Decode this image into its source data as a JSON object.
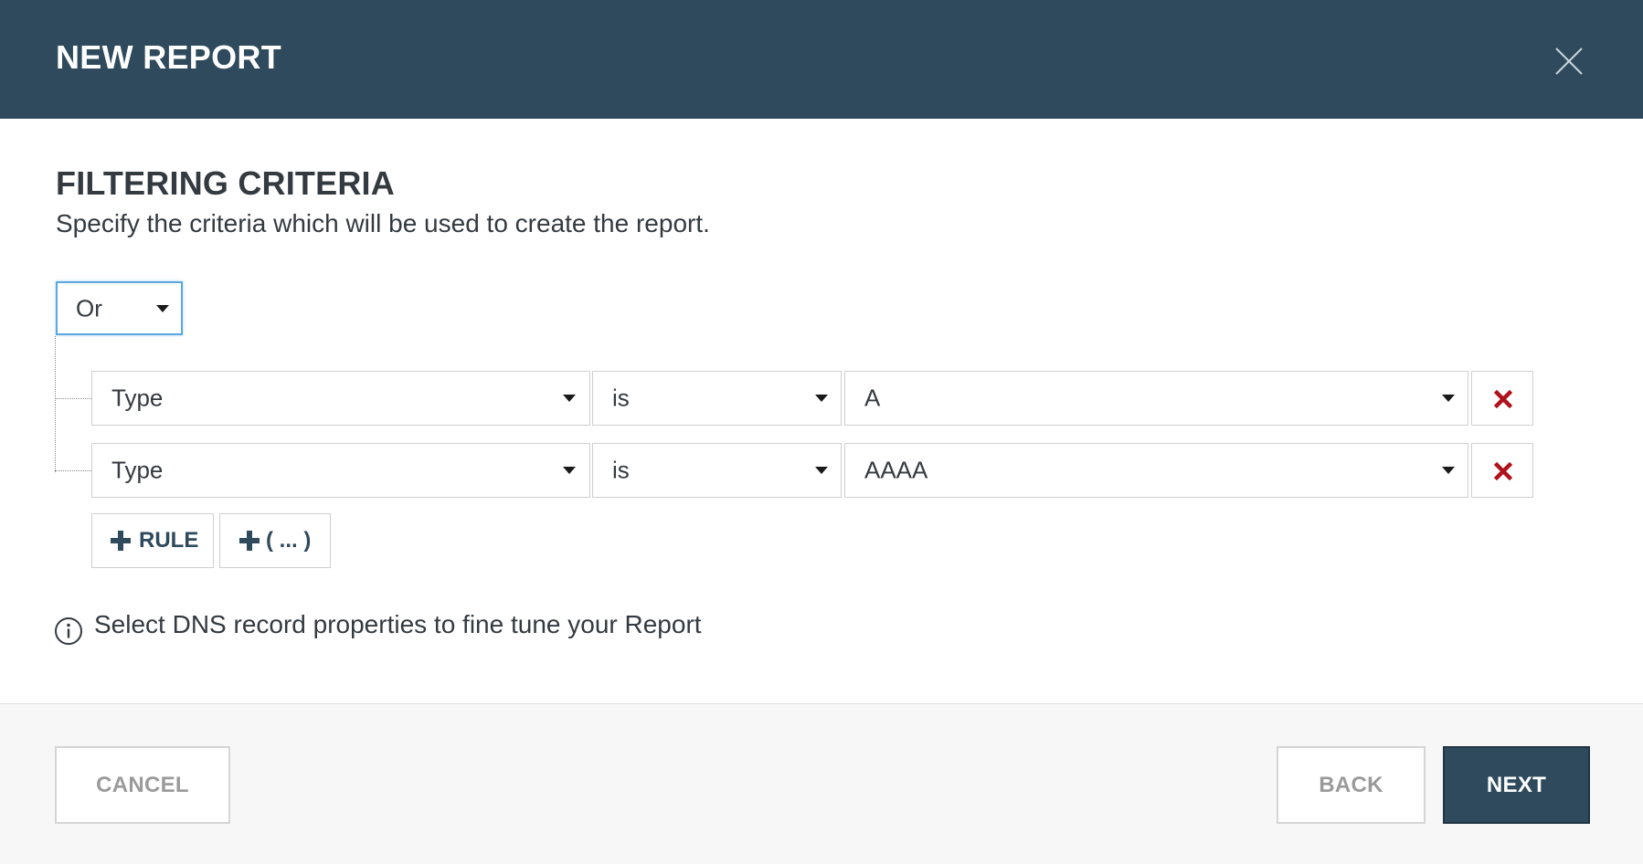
{
  "header": {
    "title": "NEW REPORT",
    "close_icon": "close-icon"
  },
  "section": {
    "title": "FILTERING CRITERIA",
    "subtitle": "Specify the criteria which will be used to create the report."
  },
  "group": {
    "operator": "Or"
  },
  "rules": [
    {
      "field": "Type",
      "operator": "is",
      "value": "A"
    },
    {
      "field": "Type",
      "operator": "is",
      "value": "AAAA"
    }
  ],
  "add_buttons": {
    "rule_label": "RULE",
    "group_label": "( ... )"
  },
  "info": {
    "text": "Select DNS record properties to fine tune your Report"
  },
  "footer": {
    "cancel_label": "CANCEL",
    "back_label": "BACK",
    "next_label": "NEXT"
  },
  "colors": {
    "header_bg": "#2e4a5c",
    "primary_button": "#2e4a5c",
    "delete_icon": "#b0121b",
    "focus_border": "#5ba8e0"
  }
}
